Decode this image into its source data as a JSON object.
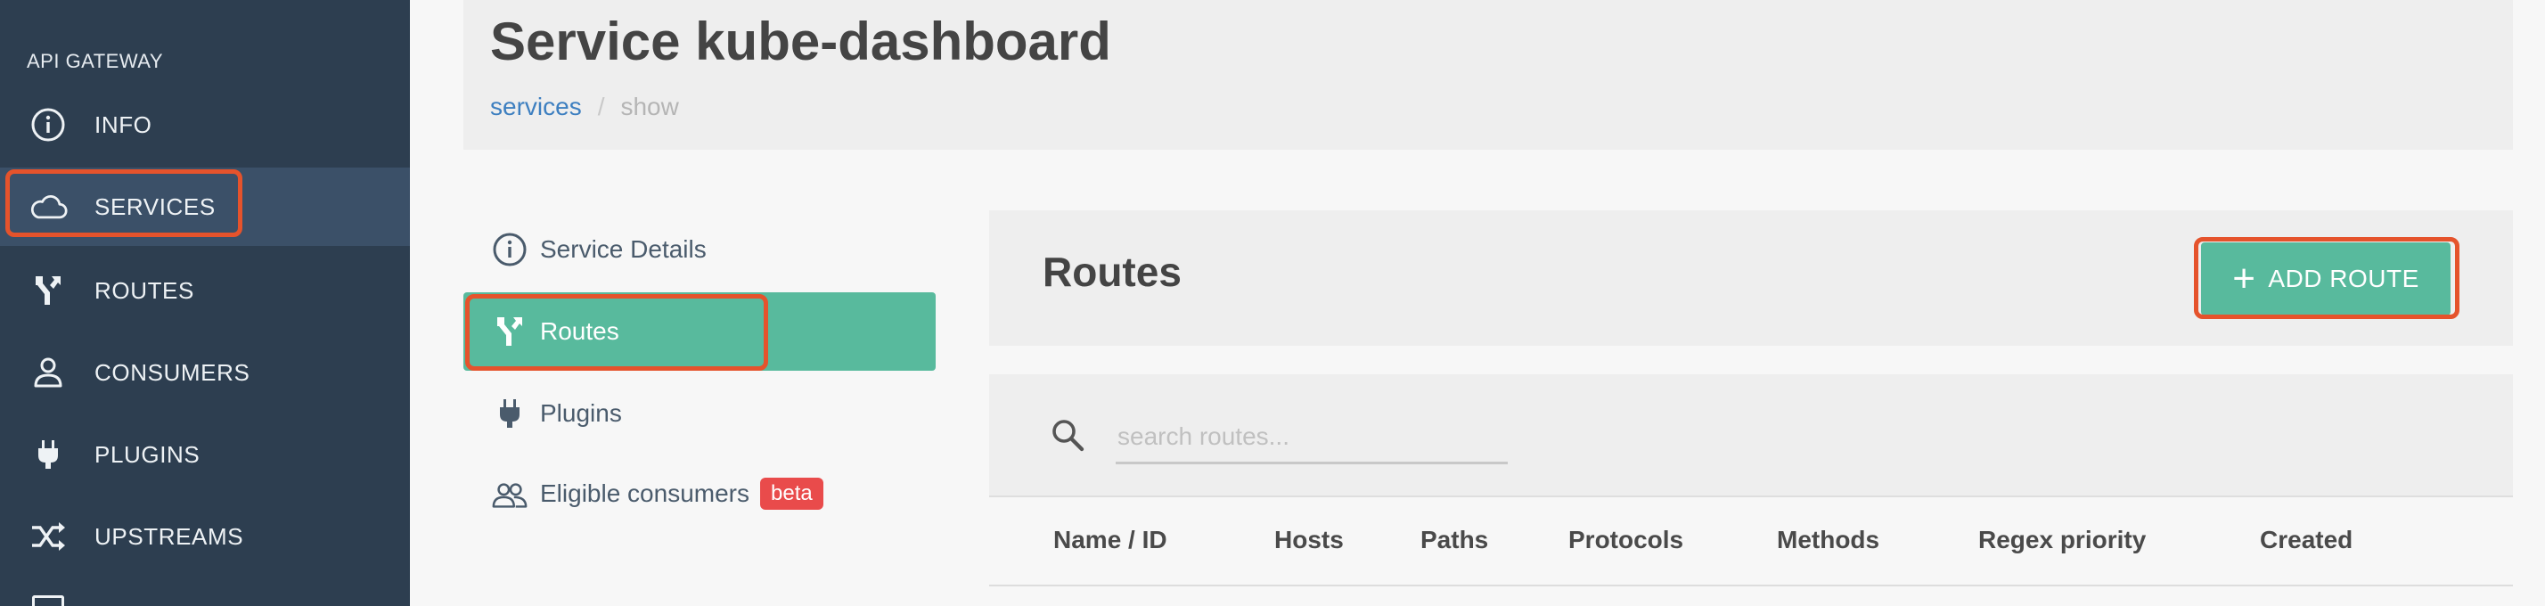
{
  "sidebar": {
    "section": "API GATEWAY",
    "items": [
      {
        "label": "INFO",
        "icon": "info-circle-icon"
      },
      {
        "label": "SERVICES",
        "icon": "cloud-icon"
      },
      {
        "label": "ROUTES",
        "icon": "route-fork-icon"
      },
      {
        "label": "CONSUMERS",
        "icon": "user-icon"
      },
      {
        "label": "PLUGINS",
        "icon": "plug-icon"
      },
      {
        "label": "UPSTREAMS",
        "icon": "shuffle-icon"
      }
    ],
    "active": "SERVICES"
  },
  "header": {
    "title": "Service kube-dashboard",
    "breadcrumb": {
      "link": "services",
      "separator": "/",
      "current": "show"
    }
  },
  "subnav": {
    "items": [
      {
        "label": "Service Details",
        "icon": "info-circle-icon"
      },
      {
        "label": "Routes",
        "icon": "route-fork-icon"
      },
      {
        "label": "Plugins",
        "icon": "plug-icon"
      },
      {
        "label": "Eligible consumers",
        "icon": "users-icon",
        "badge": "beta"
      }
    ],
    "active": "Routes"
  },
  "routes": {
    "title": "Routes",
    "add_button": "ADD ROUTE",
    "search_placeholder": "search routes...",
    "columns": [
      "Name / ID",
      "Hosts",
      "Paths",
      "Protocols",
      "Methods",
      "Regex priority",
      "Created"
    ]
  },
  "colors": {
    "sidebar_bg": "#2d3e50",
    "accent": "#58ba9d",
    "highlight": "#e5532c",
    "badge": "#e94b4b",
    "link": "#3d7fc0"
  }
}
